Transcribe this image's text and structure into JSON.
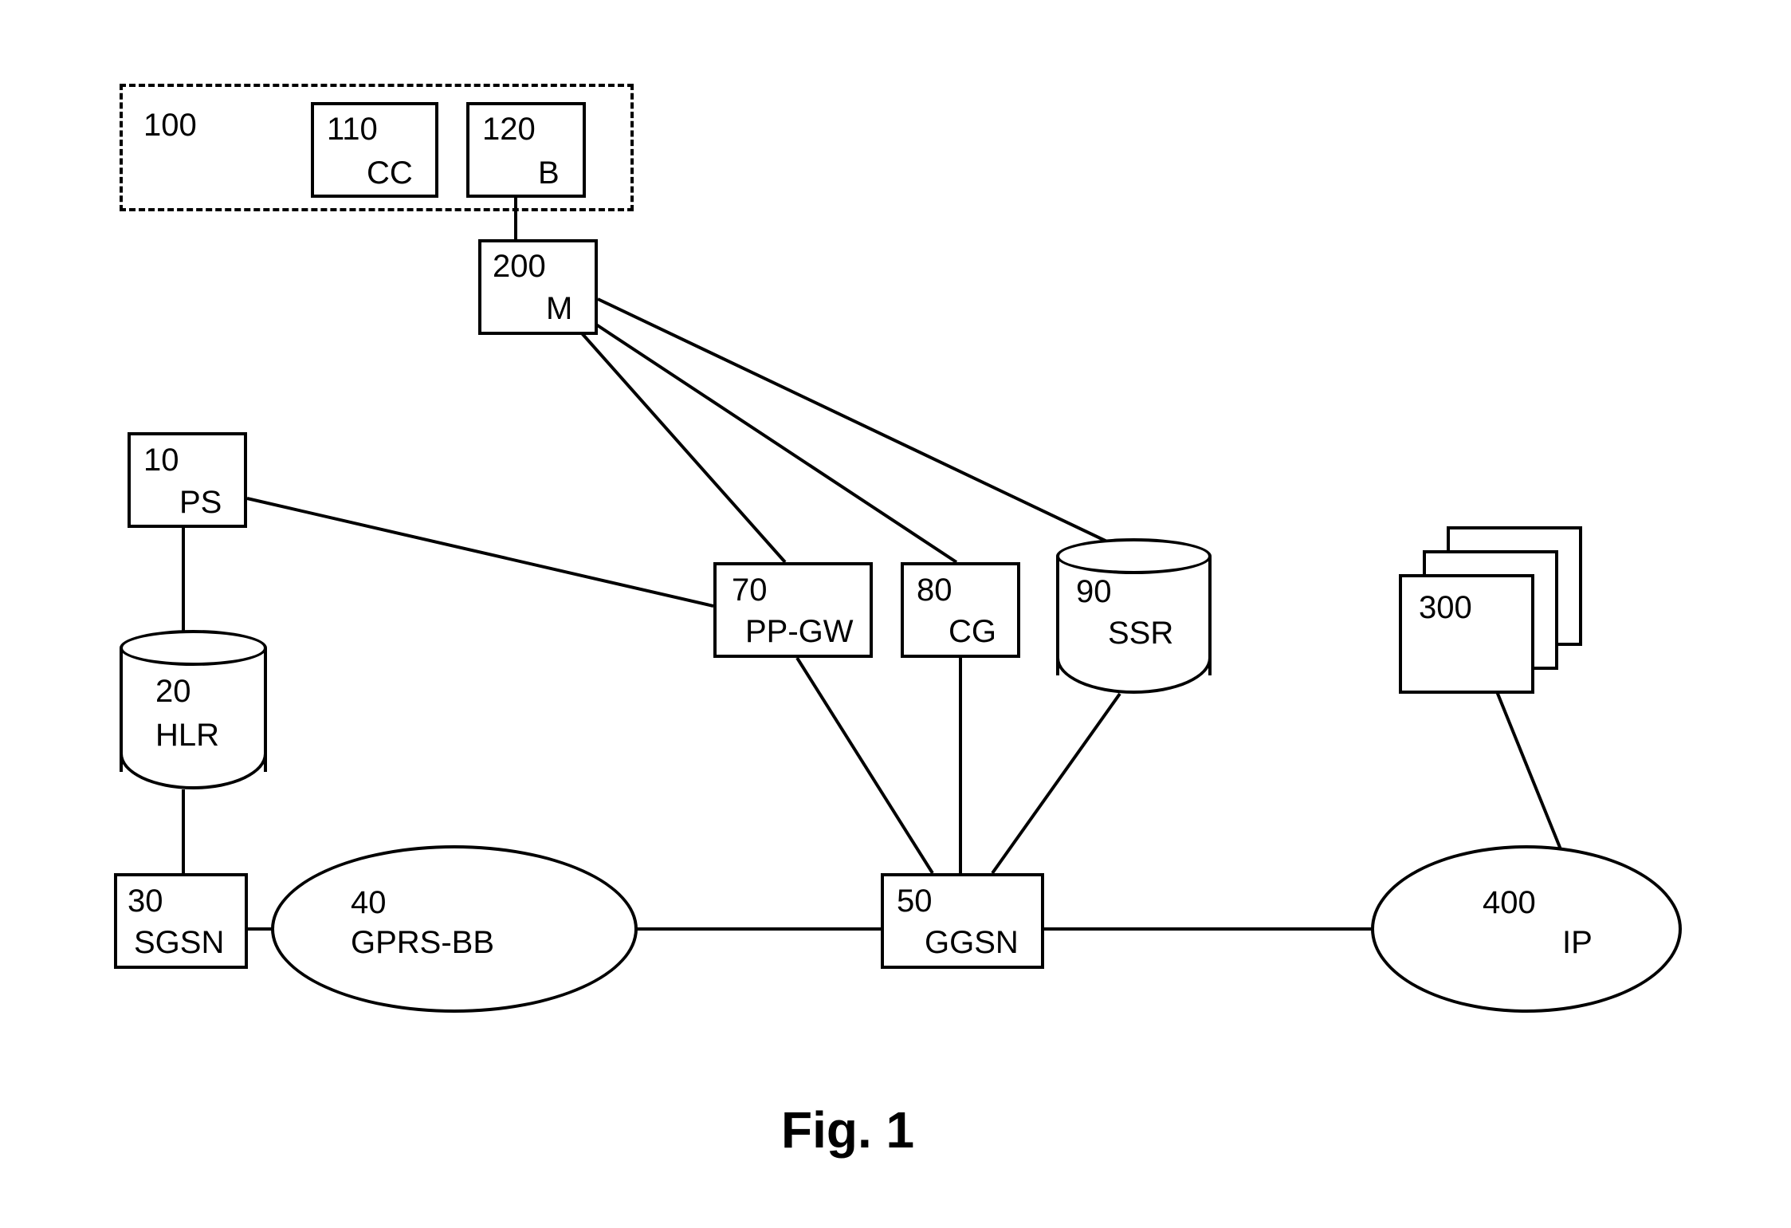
{
  "figure_caption": "Fig. 1",
  "group100": {
    "num": "100"
  },
  "node110": {
    "num": "110",
    "label": "CC"
  },
  "node120": {
    "num": "120",
    "label": "B"
  },
  "node200": {
    "num": "200",
    "label": "M"
  },
  "node10": {
    "num": "10",
    "label": "PS"
  },
  "node20": {
    "num": "20",
    "label": "HLR"
  },
  "node30": {
    "num": "30",
    "label": "SGSN"
  },
  "node40": {
    "num": "40",
    "label": "GPRS-BB"
  },
  "node50": {
    "num": "50",
    "label": "GGSN"
  },
  "node70": {
    "num": "70",
    "label": "PP-GW"
  },
  "node80": {
    "num": "80",
    "label": "CG"
  },
  "node90": {
    "num": "90",
    "label": "SSR"
  },
  "node300": {
    "num": "300"
  },
  "node400": {
    "num": "400",
    "label": "IP"
  }
}
